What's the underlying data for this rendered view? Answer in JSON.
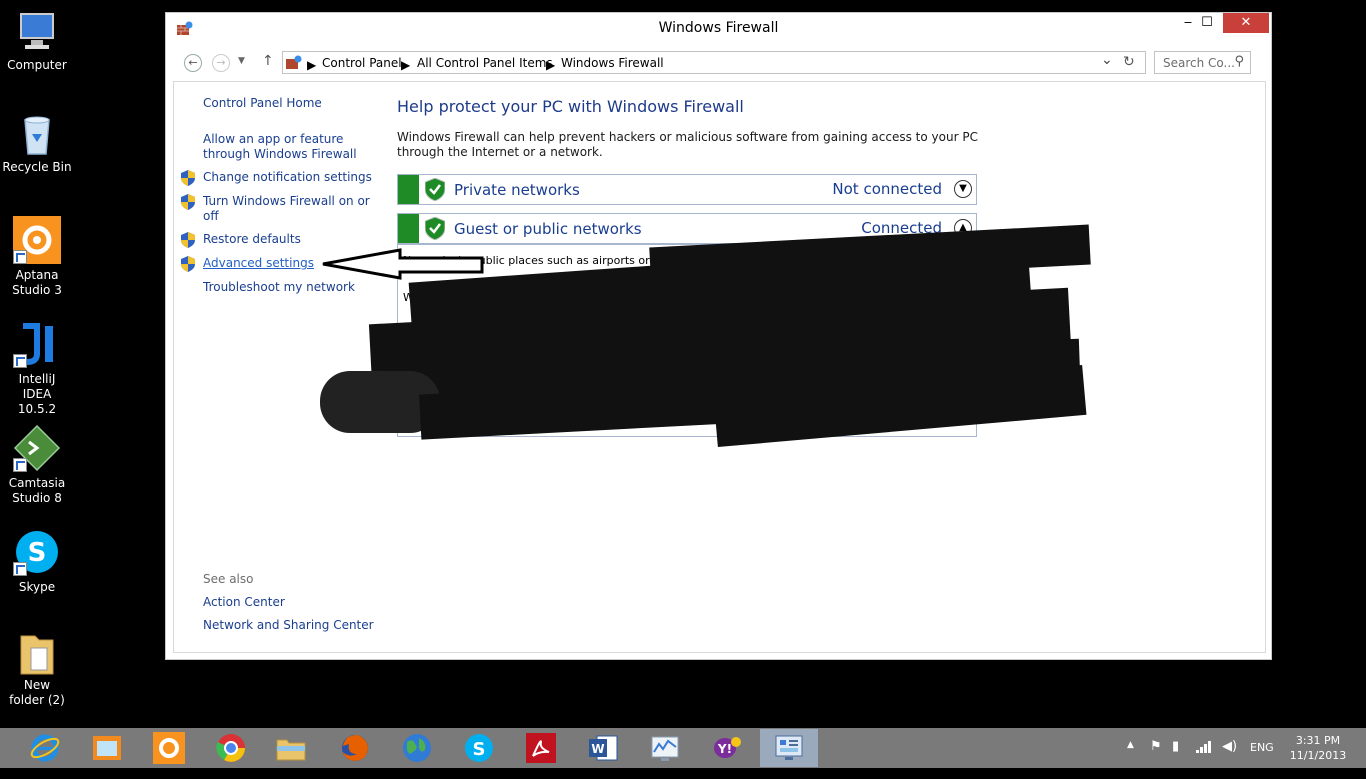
{
  "desktop_icons": [
    {
      "label": "Computer"
    },
    {
      "label": "Recycle Bin"
    },
    {
      "label": "Aptana Studio 3"
    },
    {
      "label": "IntelliJ IDEA 10.5.2"
    },
    {
      "label": "Camtasia Studio 8"
    },
    {
      "label": "Skype"
    },
    {
      "label": "New folder (2)"
    }
  ],
  "window": {
    "title": "Windows Firewall",
    "minimize": "‒",
    "maximize": "☐",
    "close": "✕"
  },
  "address_bar": {
    "crumbs": [
      "Control Panel",
      "All Control Panel Items",
      "Windows Firewall"
    ],
    "search_placeholder": "Search Co...",
    "dropdown_arrow": "⌄",
    "refresh": "↻"
  },
  "left_pane": {
    "home": "Control Panel Home",
    "allow_app_1": "Allow an app or feature",
    "allow_app_2": "through Windows Firewall",
    "change_notifications": "Change notification settings",
    "turn_on_off_1": "Turn Windows Firewall on or",
    "turn_on_off_2": "off",
    "restore_defaults": "Restore defaults",
    "advanced_settings": "Advanced settings",
    "troubleshoot": "Troubleshoot my network",
    "see_also": "See also",
    "action_center": "Action Center",
    "network_sharing": "Network and Sharing Center"
  },
  "main": {
    "title": "Help protect your PC with Windows Firewall",
    "desc": "Windows Firewall can help prevent hackers or malicious software from gaining access to your PC through the Internet or a network.",
    "private_label": "Private networks",
    "private_status": "Not connected",
    "public_label": "Guest or public networks",
    "public_status": "Connected",
    "public_detail": "Networks in public places such as airports or coffee shops",
    "public_detail_2": "Wi"
  },
  "tray": {
    "lang": "ENG",
    "time": "3:31 PM",
    "date": "11/1/2013"
  },
  "colors": {
    "link": "#1a3e8f",
    "green_bar": "#1f8b26",
    "close_btn": "#c9403a",
    "taskbar": "#7a7a7a"
  }
}
